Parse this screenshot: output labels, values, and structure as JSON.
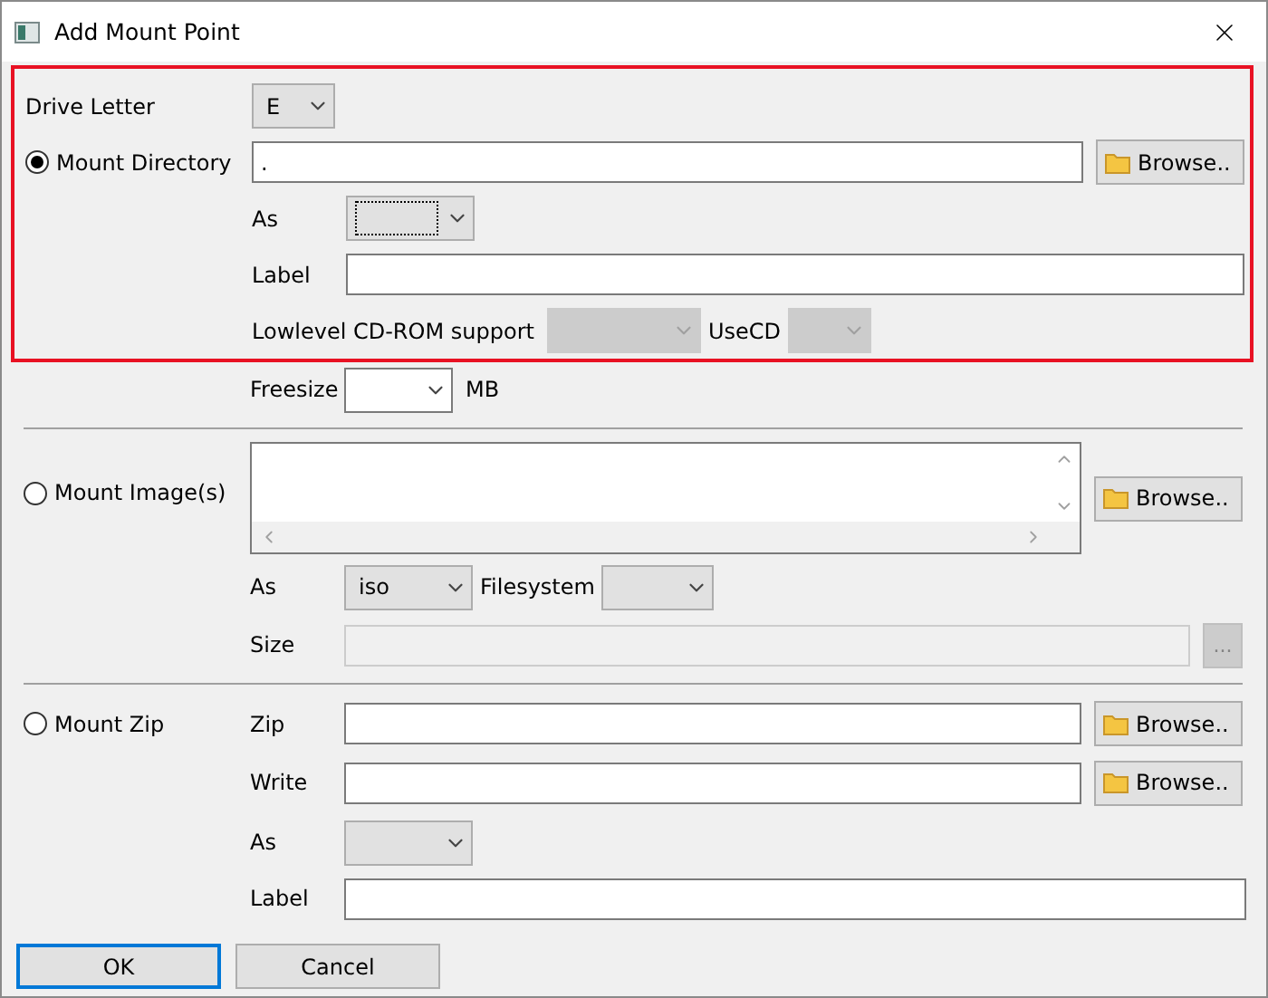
{
  "window": {
    "title": "Add Mount Point"
  },
  "directory_section": {
    "highlighted": true,
    "drive_letter": {
      "label": "Drive Letter",
      "value": "E"
    },
    "mount": {
      "label": "Mount Directory",
      "selected": true
    },
    "path": {
      "value": "."
    },
    "browse": "Browse..",
    "as": {
      "label": "As",
      "focused": true
    },
    "label_field": {
      "label": "Label"
    },
    "lowlevel": {
      "label": "Lowlevel CD-ROM support",
      "disabled": true
    },
    "usecd": {
      "label": "UseCD",
      "disabled": true
    }
  },
  "freesize": {
    "label": "Freesize",
    "unit": "MB"
  },
  "image_section": {
    "mount": {
      "label": "Mount Image(s)",
      "selected": false
    },
    "browse": "Browse..",
    "as": {
      "label": "As",
      "value": "iso"
    },
    "filesystem": {
      "label": "Filesystem"
    },
    "size": {
      "label": "Size",
      "disabled": true
    },
    "size_button": {
      "label": "...",
      "disabled": true
    }
  },
  "zip_section": {
    "mount": {
      "label": "Mount Zip",
      "selected": false
    },
    "zip": {
      "label": "Zip",
      "browse": "Browse.."
    },
    "write": {
      "label": "Write",
      "browse": "Browse.."
    },
    "as": {
      "label": "As"
    },
    "label_field": {
      "label": "Label"
    }
  },
  "buttons": [
    {
      "label": "OK",
      "default": true
    },
    {
      "label": "Cancel",
      "default": false
    }
  ]
}
